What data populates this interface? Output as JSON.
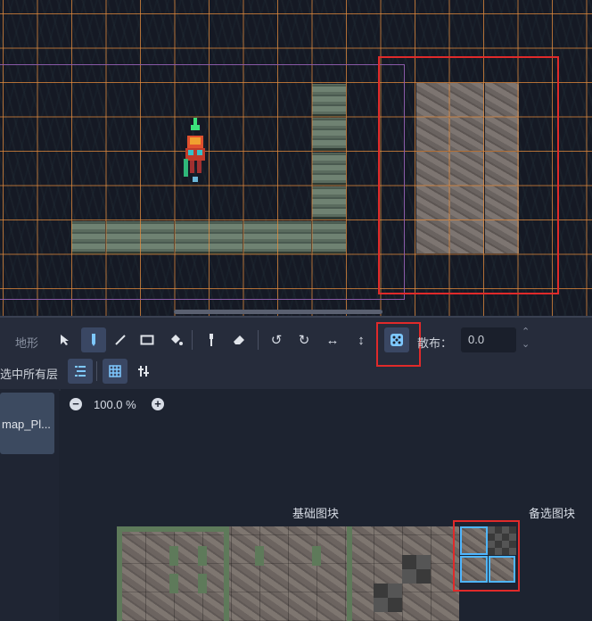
{
  "toolbar": {
    "terrain_tab": "地形",
    "scatter_label": "散布：",
    "scatter_value": "0.0",
    "highlight_layers_label": "选中所有层"
  },
  "sources": {
    "items": [
      {
        "label": "map_Pl..."
      }
    ]
  },
  "atlas": {
    "zoom_level": "100.0 %",
    "base_tiles_label": "基础图块",
    "alt_tiles_label": "备选图块"
  },
  "colors": {
    "highlight": "#e02a2a",
    "grid": "#e68c3c",
    "selection": "#4fb6ff",
    "active_button": "#3a4763"
  },
  "icons": {
    "select": "arrow-pointer-icon",
    "paint": "pencil-icon",
    "line": "line-icon",
    "rect": "rectangle-icon",
    "bucket": "paint-bucket-icon",
    "picker": "eyedropper-icon",
    "eraser": "eraser-icon",
    "rotate_left": "rotate-left-icon",
    "rotate_right": "rotate-right-icon",
    "flip_h": "flip-horizontal-icon",
    "flip_v": "flip-vertical-icon",
    "random": "dice-icon",
    "layers": "layers-list-icon",
    "grid": "grid-icon",
    "settings": "tools-icon",
    "zoom_out": "zoom-out-icon",
    "zoom_in": "zoom-in-icon"
  }
}
